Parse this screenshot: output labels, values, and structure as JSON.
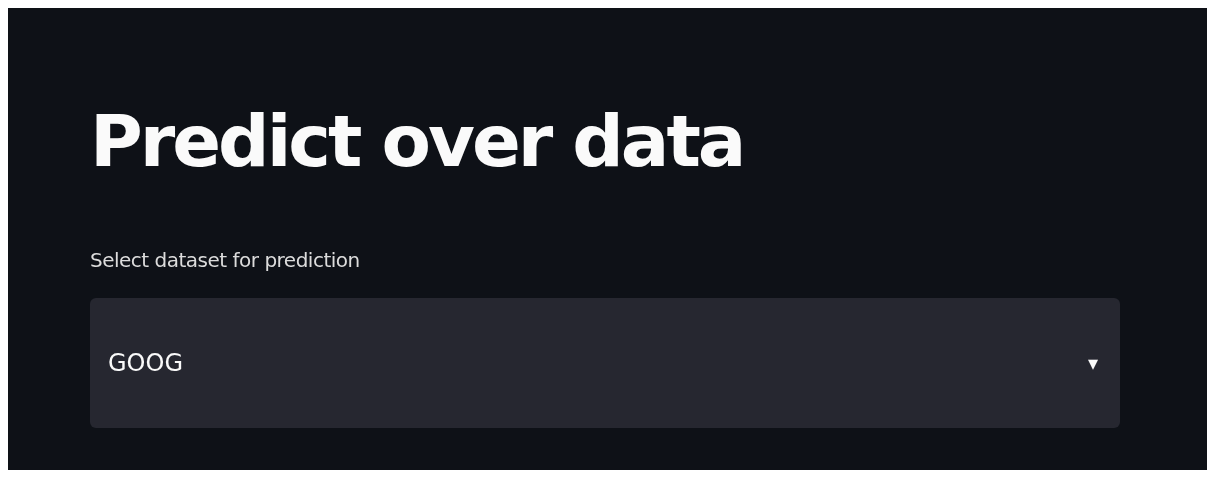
{
  "title": "Predict over data",
  "select": {
    "label": "Select dataset for prediction",
    "value": "GOOG",
    "caret": "▾"
  }
}
